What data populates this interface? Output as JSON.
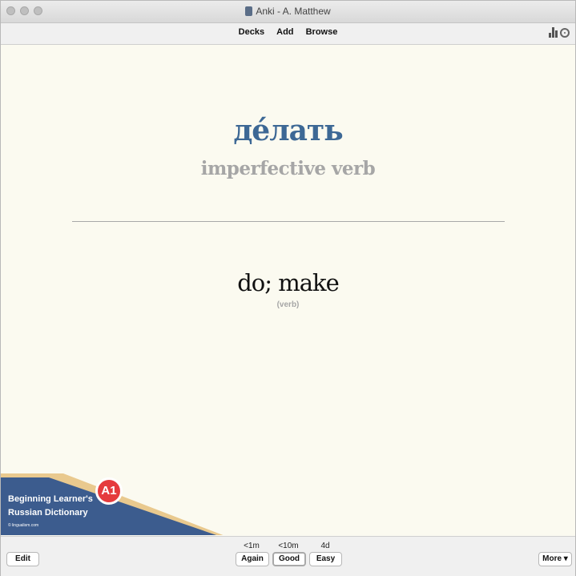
{
  "window": {
    "title": "Anki - A. Matthew",
    "traffic_lights": [
      "close-icon",
      "minimize-icon",
      "zoom-icon"
    ]
  },
  "toolbar": {
    "decks": "Decks",
    "add": "Add",
    "browse": "Browse",
    "icons": [
      "stats-icon",
      "sync-icon"
    ]
  },
  "card": {
    "word": "де́лать",
    "part_of_speech": "imperfective verb",
    "meaning": "do; make",
    "meaning_sub": "(verb)"
  },
  "banner": {
    "line1": "Beginning Learner's",
    "line2": "Russian Dictionary",
    "site": "© lingualism.com",
    "level": "A1",
    "colors": {
      "blue": "#3c5c8e",
      "tan": "#e9c98e",
      "badge": "#e53b3d"
    }
  },
  "bottom": {
    "edit": "Edit",
    "more": "More ▾",
    "answers": [
      {
        "time": "<1m",
        "label": "Again"
      },
      {
        "time": "<10m",
        "label": "Good"
      },
      {
        "time": "4d",
        "label": "Easy"
      }
    ]
  },
  "colors": {
    "word": "#3d6895",
    "muted": "#a6a6a6",
    "background": "#fbfaf0"
  }
}
